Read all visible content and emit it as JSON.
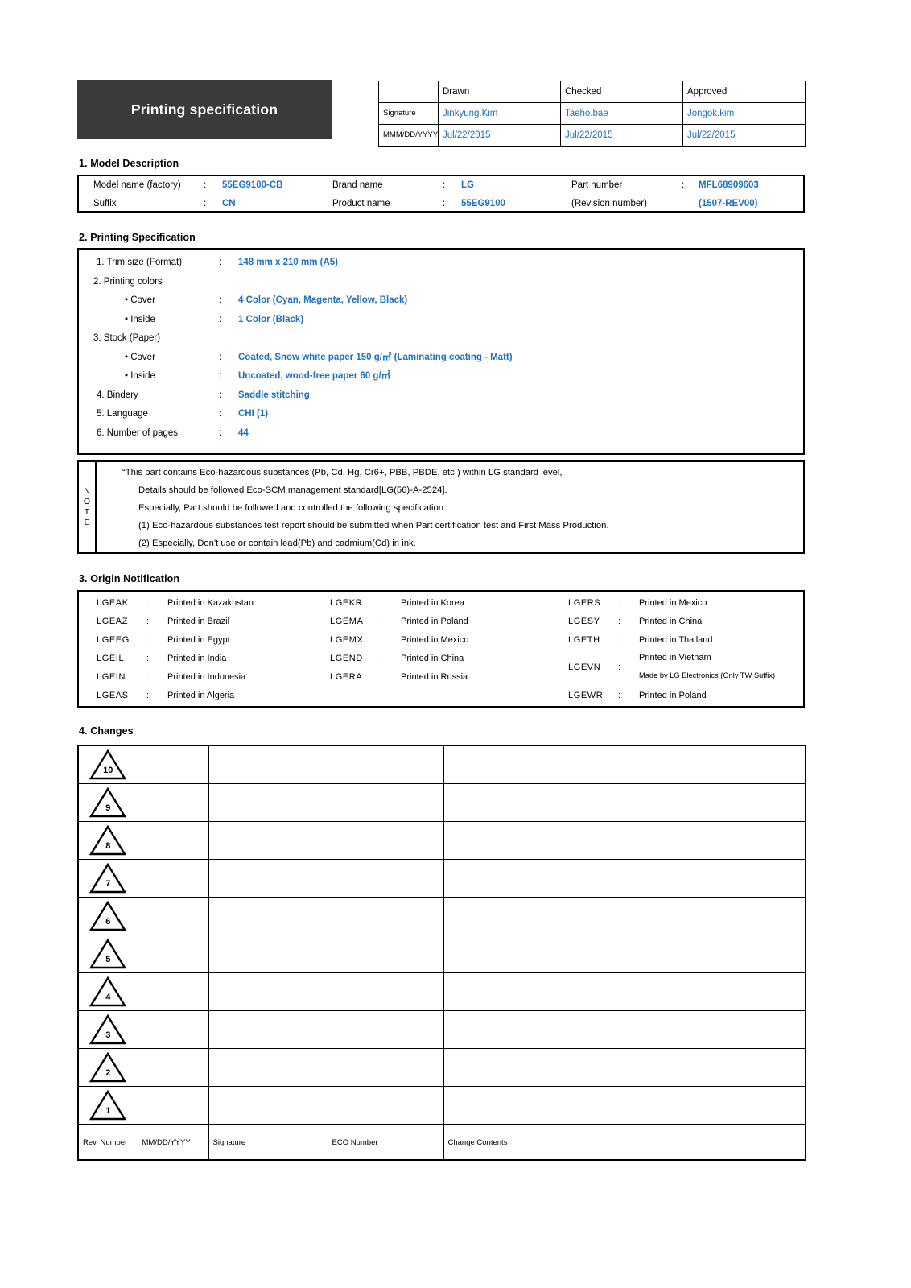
{
  "document": {
    "title": "Printing specification"
  },
  "approval": {
    "columns": [
      "",
      "Drawn",
      "Checked",
      "Approved"
    ],
    "row_labels": [
      "Signature",
      "MMM/DD/YYYY"
    ],
    "signatures": [
      "Jinkyung.Kim",
      "Taeho.bae",
      "Jongok.kim"
    ],
    "dates": [
      "Jul/22/2015",
      "Jul/22/2015",
      "Jul/22/2015"
    ]
  },
  "sections": {
    "s1_heading": "1. Model Description",
    "s2_heading": "2. Printing Specification",
    "s3_heading": "3. Origin Notification",
    "s4_heading": "4. Changes"
  },
  "model_description": {
    "model_name_label": "Model name (factory)",
    "model_name_value": "55EG9100-CB",
    "brand_name_label": "Brand name",
    "brand_name_value": "LG",
    "part_number_label": "Part number",
    "part_number_value": "MFL68909603",
    "suffix_label": "Suffix",
    "suffix_value": "CN",
    "product_name_label": "Product name",
    "product_name_value": "55EG9100",
    "revision_number_label": "(Revision number)",
    "revision_number_value": "(1507-REV00)",
    "colon": ":"
  },
  "printing_specification": {
    "colon": ":",
    "trim_size_label": "1. Trim size (Format)",
    "trim_size_value": "148 mm x 210 mm (A5)",
    "printing_colors_label": "2. Printing colors",
    "colors_cover_label": "• Cover",
    "colors_cover_value": "4 Color (Cyan, Magenta, Yellow, Black)",
    "colors_inside_label": "• Inside",
    "colors_inside_value": "1 Color (Black)",
    "stock_label": "3. Stock (Paper)",
    "stock_cover_label": "• Cover",
    "stock_cover_value": "Coated, Snow white paper 150 g/㎡  (Laminating coating - Matt)",
    "stock_inside_label": "• Inside",
    "stock_inside_value": "Uncoated, wood-free paper 60 g/㎡",
    "bindery_label": "4. Bindery",
    "bindery_value": "Saddle stitching",
    "language_label": "5. Language",
    "language_value": "CHI (1)",
    "pages_label": "6. Number of pages",
    "pages_value": "44"
  },
  "note": {
    "label_letters": [
      "N",
      "O",
      "T",
      "E"
    ],
    "lines": [
      "“This part contains Eco-hazardous substances (Pb, Cd, Hg, Cr6+, PBB, PBDE, etc.) within LG standard level,",
      "Details should be followed Eco-SCM management standard[LG(56)-A-2524].",
      "Especially, Part should be followed and controlled the following specification.",
      "(1) Eco-hazardous substances test report should be submitted when Part certification test and First Mass Production.",
      "(2) Especially, Don't use or contain lead(Pb) and cadmium(Cd) in ink."
    ]
  },
  "origin_notification": {
    "colon": ":",
    "col1": [
      {
        "code": "LGEAK",
        "text": "Printed in Kazakhstan"
      },
      {
        "code": "LGEAZ",
        "text": "Printed in Brazil"
      },
      {
        "code": "LGEEG",
        "text": "Printed in Egypt"
      },
      {
        "code": "LGEIL",
        "text": "Printed in India"
      },
      {
        "code": "LGEIN",
        "text": "Printed in Indonesia"
      },
      {
        "code": "LGEAS",
        "text": "Printed in Algeria"
      }
    ],
    "col2": [
      {
        "code": "LGEKR",
        "text": "Printed in Korea"
      },
      {
        "code": "LGEMA",
        "text": "Printed in Poland"
      },
      {
        "code": "LGEMX",
        "text": "Printed in Mexico"
      },
      {
        "code": "LGEND",
        "text": "Printed in China"
      },
      {
        "code": "LGERA",
        "text": "Printed in Russia"
      }
    ],
    "col3": [
      {
        "code": "LGERS",
        "text": "Printed in Mexico"
      },
      {
        "code": "LGESY",
        "text": "Printed in China"
      },
      {
        "code": "LGETH",
        "text": "Printed in Thailand"
      },
      {
        "code": "LGEVN",
        "text": "Printed in Vietnam",
        "text2": "Made by LG Electronics (Only TW Suffix)"
      },
      {
        "code": "LGEWR",
        "text": "Printed in Poland"
      }
    ]
  },
  "changes": {
    "rows": [
      "10",
      "9",
      "8",
      "7",
      "6",
      "5",
      "4",
      "3",
      "2",
      "1"
    ],
    "footer": [
      "Rev. Number",
      "MM/DD/YYYY",
      "Signature",
      "ECO Number",
      "Change Contents"
    ]
  },
  "colors": {
    "accent_blue": "#1f70c1",
    "title_bg": "#3a3a3a",
    "border": "#000000"
  }
}
